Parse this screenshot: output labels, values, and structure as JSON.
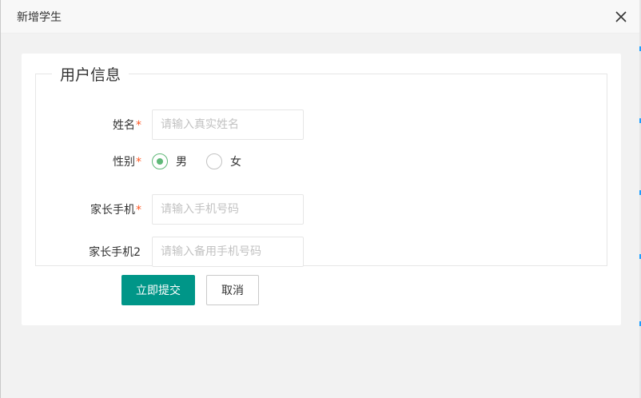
{
  "dialog": {
    "title": "新增学生"
  },
  "form": {
    "fieldset_legend": "用户信息",
    "fields": [
      {
        "label": "姓名",
        "required": "*",
        "placeholder": "请输入真实姓名",
        "value": ""
      },
      {
        "label": "性别",
        "required": "*",
        "options": [
          "男",
          "女"
        ],
        "selected": "男"
      },
      {
        "label": "家长手机",
        "required": "*",
        "placeholder": "请输入手机号码",
        "value": ""
      },
      {
        "label": "家长手机2",
        "required": "",
        "placeholder": "请输入备用手机号码",
        "value": ""
      }
    ],
    "submit_label": "立即提交",
    "cancel_label": "取消"
  },
  "colors": {
    "primary": "#009688",
    "radio_checked": "#5fb878",
    "required": "#ff5722"
  },
  "icons": {
    "close": "close-icon"
  }
}
